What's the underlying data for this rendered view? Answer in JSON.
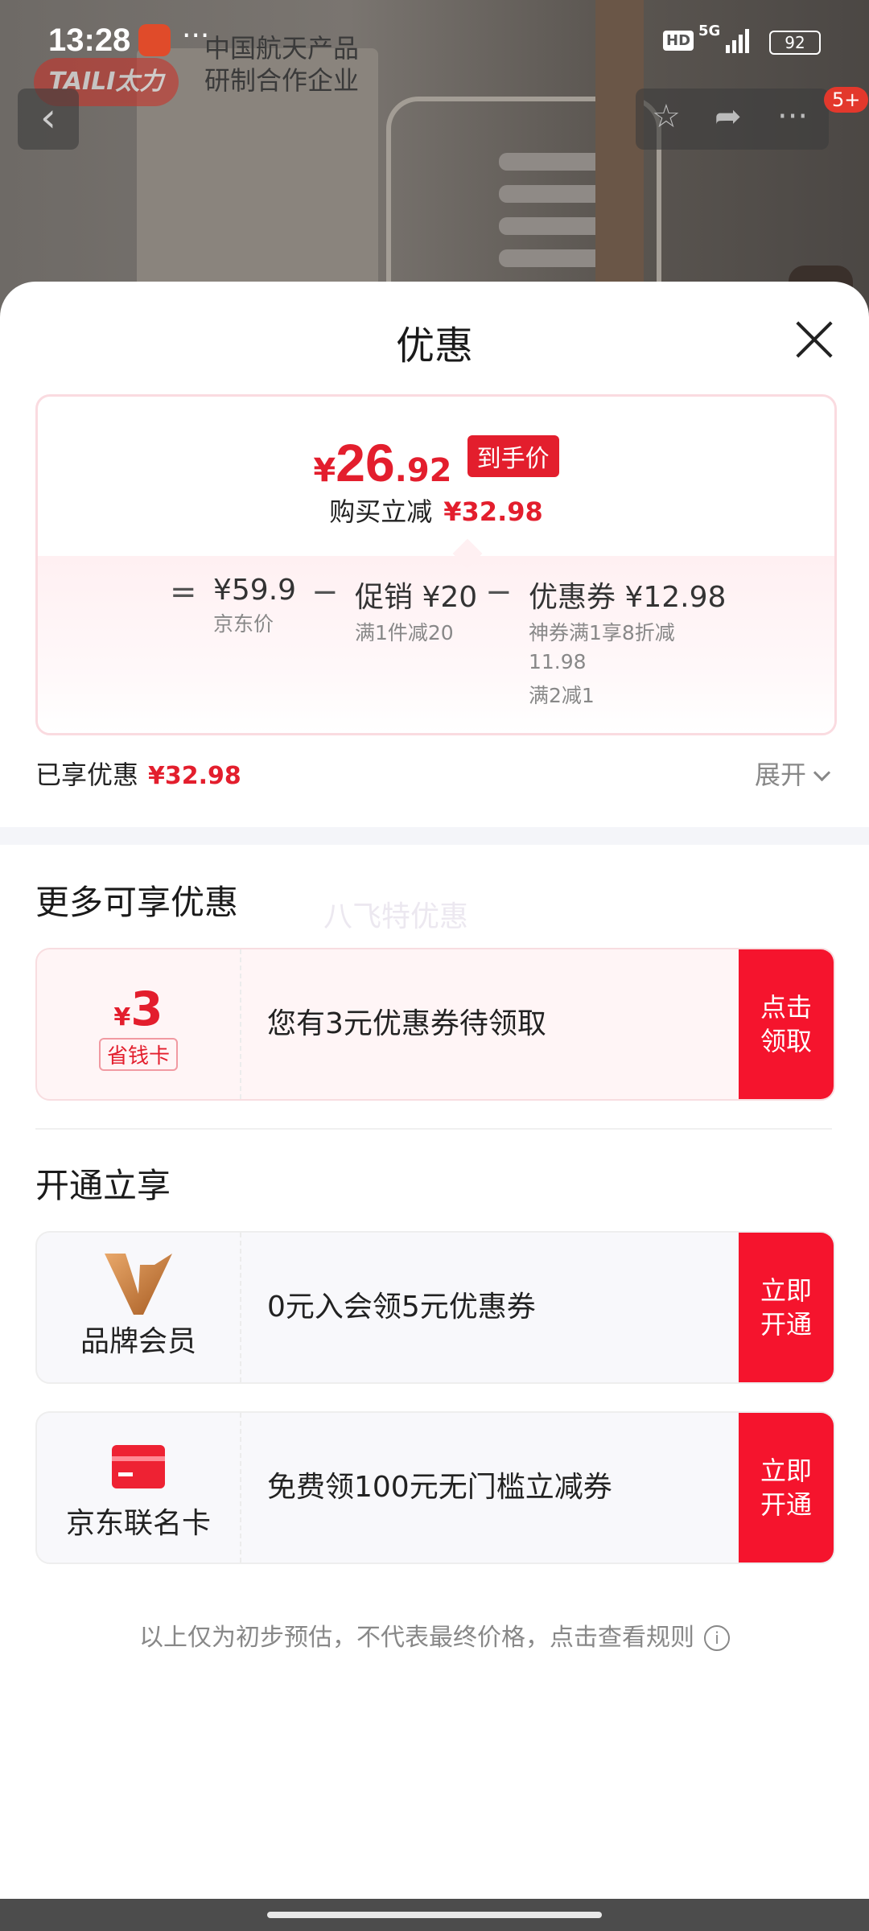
{
  "status_bar": {
    "time": "13:28",
    "network": "5G",
    "battery": "92"
  },
  "background": {
    "brand_logo": "TAILI太力",
    "brand_tagline": "中国航天产品\n研制合作企业",
    "cart_badge": "5+"
  },
  "sheet": {
    "title": "优惠",
    "final_price": {
      "yen": "¥",
      "integer": "26",
      "decimal": ".92",
      "tag": "到手价"
    },
    "instant_reduction": {
      "label": "购买立减",
      "value": "¥32.98"
    },
    "formula": {
      "eq": "=",
      "jd_price": {
        "value": "¥59.9",
        "label": "京东价"
      },
      "minus1": "−",
      "promotion": {
        "value": "促销 ¥20",
        "label": "满1件减20"
      },
      "minus2": "−",
      "coupon": {
        "value": "优惠券 ¥12.98",
        "detail1": "神券满1享8折减",
        "detail2": "11.98",
        "detail3": "满2减1"
      }
    },
    "enjoyed": {
      "label": "已享优惠",
      "value": "¥32.98"
    },
    "expand_label": "展开",
    "more_offers_title": "更多可享优惠",
    "watermark": "八飞特优惠",
    "coupon_offer": {
      "yen": "¥",
      "amount": "3",
      "tag": "省钱卡",
      "text": "您有3元优惠券待领取",
      "button": "点击\n领取"
    },
    "open_title": "开通立享",
    "brand_member": {
      "label": "品牌会员",
      "text": "0元入会领5元优惠券",
      "button": "立即\n开通"
    },
    "jd_card": {
      "label": "京东联名卡",
      "text": "免费领100元无门槛立减券",
      "button": "立即\n开通"
    },
    "footer_note": "以上仅为初步预估，不代表最终价格，点击查看规则",
    "info_icon": "i"
  },
  "colors": {
    "accent_red": "#e31e2d",
    "button_red": "#f5142d"
  }
}
